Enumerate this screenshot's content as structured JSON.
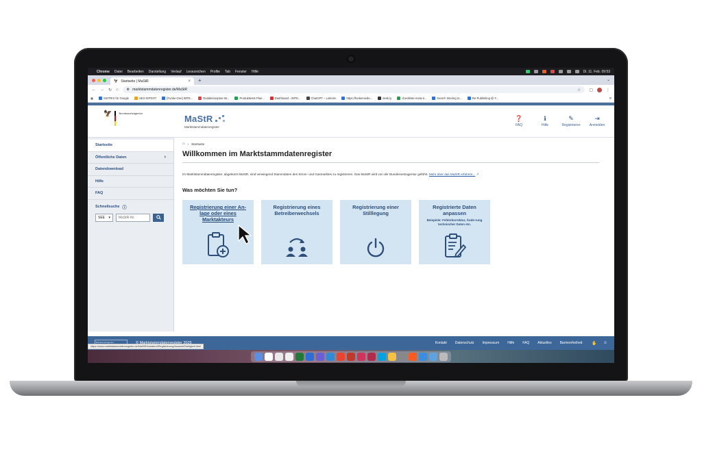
{
  "menubar": {
    "apple": "",
    "items": [
      "Chrome",
      "Datei",
      "Bearbeiten",
      "Darstellung",
      "Verlauf",
      "Lesezeichen",
      "Profile",
      "Tab",
      "Fenster",
      "Hilfe"
    ],
    "clock": "Di. 11. Feb. 09:53"
  },
  "browser": {
    "tab_title": "Startseite | MaStR",
    "tab_close": "×",
    "new_tab": "+",
    "url": "marktstammdatenregister.de/MaStR",
    "bookmarks": [
      {
        "label": "SISTRIX für Google",
        "color": "#2f6fd6"
      },
      {
        "label": "SEO IMTEST",
        "color": "#f0a020"
      },
      {
        "label": "[Funke-One] IMTE...",
        "color": "#2f6fd6"
      },
      {
        "label": "Redaktionsplan IM...",
        "color": "#e04040"
      },
      {
        "label": "Produkttests Plan...",
        "color": "#22a050"
      },
      {
        "label": "Dashboard › IMTE...",
        "color": "#d03030"
      },
      {
        "label": "ChatGPT – Lektorin",
        "color": "#444444"
      },
      {
        "label": "https://funkemedie...",
        "color": "#2f6fd6"
      },
      {
        "label": "desk.ly",
        "color": "#333333"
      },
      {
        "label": "checkliste-meta-ti...",
        "color": "#22a050"
      },
      {
        "label": "Search Intering to...",
        "color": "#2f6fd6"
      },
      {
        "label": "Re-Publishing @ F...",
        "color": "#2f6fd6"
      }
    ],
    "bookmarks_more": "»",
    "status_url": "https://www.marktstammdatenregister.de/MaStR/Assistent/Registrierung/AuswahlTaetigkeit.html"
  },
  "header": {
    "ministry": "Bundesnetzagentur",
    "brand": "MaStR",
    "brand_sub": "Marktstammdatenregister",
    "nav": [
      {
        "label": "FAQ",
        "icon": "question-circle-icon",
        "glyph": "❓"
      },
      {
        "label": "Hilfe",
        "icon": "info-circle-icon",
        "glyph": "ℹ"
      },
      {
        "label": "Registrieren",
        "icon": "edit-icon",
        "glyph": "✎"
      },
      {
        "label": "Anmelden",
        "icon": "login-icon",
        "glyph": "⇥"
      }
    ]
  },
  "sidebar": {
    "items": [
      {
        "label": "Startseite",
        "chevron": ""
      },
      {
        "label": "Öffentliche Daten",
        "chevron": "›"
      },
      {
        "label": "Datendownload",
        "chevron": ""
      },
      {
        "label": "Hilfe",
        "chevron": ""
      },
      {
        "label": "FAQ",
        "chevron": ""
      }
    ],
    "quick_label": "Schnellsuche",
    "select_value": "SEE",
    "input_placeholder": "MaStR-Nr."
  },
  "main": {
    "breadcrumb": "Startseite",
    "title": "Willkommen im Marktstammdatenregister",
    "intro": "Im Marktstammdatenregister, abgekürzt MaStR, sind verwiegend Stammdaten des Strom- und Gasmarktes zu registrieren. Das MaStR wird von der Bundesnetzagentur geführt.",
    "intro_link": "Mehr über das MaStR erfahren...",
    "question": "Was möchten Sie tun?",
    "cards": [
      {
        "title": "Registrierung einer An-lage oder eines Marktakteurs",
        "sub": "",
        "icon": "clipboard-plus-icon"
      },
      {
        "title": "Registrierung eines Betreiberwechsels",
        "sub": "",
        "icon": "operator-change-icon"
      },
      {
        "title": "Registrierung einer Stilllegung",
        "sub": "",
        "icon": "power-icon"
      },
      {
        "title": "Registrierte Daten anpassen",
        "sub": "Beispiele: Fehlerkorrektur, Ände-rung technischer Daten etc.",
        "icon": "clipboard-edit-icon"
      }
    ]
  },
  "footer": {
    "logo_text": "Bundesnetzagentur",
    "copyright": "© Marktstammdatenregister 2025",
    "links": [
      "Kontakt",
      "Datenschutz",
      "Impressum",
      "Hilfe",
      "FAQ",
      "Aktuelles",
      "Barrierefreiheit"
    ]
  },
  "colors": {
    "accent": "#3d6799",
    "card_bg": "#d3e4f2",
    "link": "#2a5aa0"
  }
}
